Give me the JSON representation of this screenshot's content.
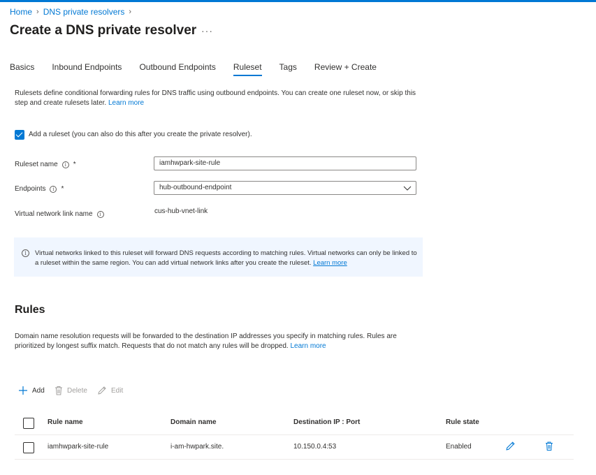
{
  "breadcrumb": {
    "items": [
      "Home",
      "DNS private resolvers"
    ]
  },
  "page_title": "Create a DNS private resolver",
  "more_label": "···",
  "tabs": [
    "Basics",
    "Inbound Endpoints",
    "Outbound Endpoints",
    "Ruleset",
    "Tags",
    "Review + Create"
  ],
  "active_tab": "Ruleset",
  "ruleset": {
    "description": "Rulesets define conditional forwarding rules for DNS traffic using outbound endpoints. You can create one ruleset now, or skip this step and create rulesets later.",
    "learn_more": "Learn more",
    "add_checkbox_label": "Add a ruleset (you can also do this after you create the private resolver).",
    "add_checked": true,
    "name_label": "Ruleset name",
    "name_value": "iamhwpark-site-rule",
    "endpoints_label": "Endpoints",
    "endpoints_value": "hub-outbound-endpoint",
    "vnet_link_label": "Virtual network link name",
    "vnet_link_value": "cus-hub-vnet-link",
    "required_mark": "*",
    "info_bar_text": "Virtual networks linked to this ruleset will forward DNS requests according to matching rules. Virtual networks can only be linked to a ruleset within the same region. You can add virtual network links after you create the ruleset.",
    "info_bar_link": "Learn more"
  },
  "rules": {
    "heading": "Rules",
    "description": "Domain name resolution requests will be forwarded to the destination IP addresses you specify in matching rules. Rules are prioritized by longest suffix match. Requests that do not match any rules will be dropped.",
    "learn_more": "Learn more",
    "toolbar": {
      "add": "Add",
      "delete": "Delete",
      "edit": "Edit"
    },
    "columns": [
      "Rule name",
      "Domain name",
      "Destination IP : Port",
      "Rule state"
    ],
    "rows": [
      {
        "rule_name": "iamhwpark-site-rule",
        "domain_name": "i-am-hwpark.site.",
        "destination": "10.150.0.4:53",
        "state": "Enabled"
      }
    ]
  },
  "colors": {
    "accent": "#0078d4",
    "info_bg": "#f0f6ff",
    "text": "#323130"
  }
}
